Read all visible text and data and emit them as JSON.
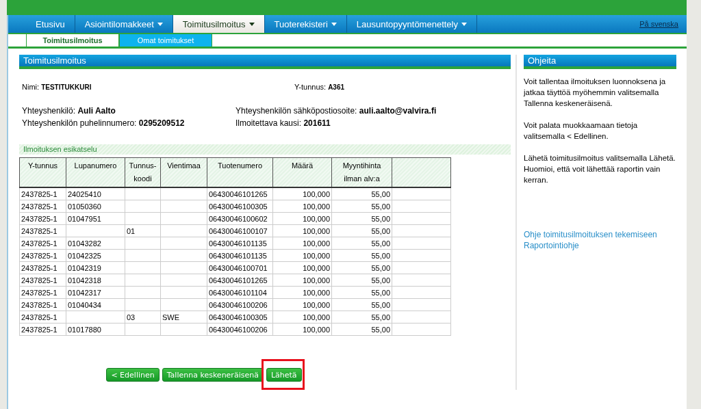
{
  "nav": {
    "tabs": [
      {
        "label": "Etusivu",
        "dropdown": false,
        "selected": false
      },
      {
        "label": "Asiointilomakkeet",
        "dropdown": true,
        "selected": false
      },
      {
        "label": "Toimitusilmoitus",
        "dropdown": true,
        "selected": true
      },
      {
        "label": "Tuoterekisteri",
        "dropdown": true,
        "selected": false
      },
      {
        "label": "Lausuntopyyntömenettely",
        "dropdown": true,
        "selected": false
      }
    ],
    "language_link": "På svenska"
  },
  "subtabs": [
    {
      "label": "Toimitusilmoitus",
      "selected": true
    },
    {
      "label": "Omat toimitukset",
      "selected": false
    }
  ],
  "panel": {
    "title": "Toimitusilmoitus",
    "company": [
      {
        "label": "Nimi:",
        "value": "TESTITUKKURI"
      },
      {
        "label": "Y-tunnus:",
        "value": "A361"
      }
    ],
    "contact": [
      {
        "label": "Yhteyshenkilö:",
        "value": "Auli Aalto"
      },
      {
        "label": "Yhteyshenkilön sähköpostiosoite:",
        "value": "auli.aalto@valvira.fi"
      },
      {
        "label": "Yhteyshenkilön puhelinnumero:",
        "value": "0295209512"
      },
      {
        "label": "Ilmoitettava kausi:",
        "value": "201611"
      }
    ]
  },
  "preview": {
    "title": "Ilmoituksen esikatselu",
    "columns": [
      "Y-tunnus",
      "Lupanumero",
      "Tunnus-koodi",
      "Vientimaa",
      "Tuotenumero",
      "Määrä",
      "Myyntihinta ilman alv:a"
    ],
    "rows": [
      [
        "2437825-1",
        "24025410",
        null,
        null,
        "06430046101265",
        "100,000",
        "55,00"
      ],
      [
        "2437825-1",
        "01050360",
        null,
        null,
        "06430046100305",
        "100,000",
        "55,00"
      ],
      [
        "2437825-1",
        "01047951",
        null,
        null,
        "06430046100602",
        "100,000",
        "55,00"
      ],
      [
        "2437825-1",
        null,
        "01",
        null,
        "06430046100107",
        "100,000",
        "55,00"
      ],
      [
        "2437825-1",
        "01043282",
        null,
        null,
        "06430046101135",
        "100,000",
        "55,00"
      ],
      [
        "2437825-1",
        "01042325",
        null,
        null,
        "06430046101135",
        "100,000",
        "55,00"
      ],
      [
        "2437825-1",
        "01042319",
        null,
        null,
        "06430046100701",
        "100,000",
        "55,00"
      ],
      [
        "2437825-1",
        "01042318",
        null,
        null,
        "06430046101265",
        "100,000",
        "55,00"
      ],
      [
        "2437825-1",
        "01042317",
        null,
        null,
        "06430046101104",
        "100,000",
        "55,00"
      ],
      [
        "2437825-1",
        "01040434",
        null,
        null,
        "06430046100206",
        "100,000",
        "55,00"
      ],
      [
        "2437825-1",
        null,
        "03",
        "SWE",
        "06430046100305",
        "100,000",
        "55,00"
      ],
      [
        "2437825-1",
        "01017880",
        null,
        null,
        "06430046100206",
        "100,000",
        "55,00"
      ]
    ]
  },
  "buttons": [
    {
      "label": "< Edellinen",
      "highlighted": false
    },
    {
      "label": "Tallenna keskeneräisenä",
      "highlighted": false
    },
    {
      "label": "Lähetä",
      "highlighted": true
    }
  ],
  "help": {
    "title": "Ohjeita",
    "paragraphs": [
      "Voit tallentaa ilmoituksen luonnoksena ja jatkaa täyttöä myöhemmin valitsemalla Tallenna keskeneräisenä.",
      "Voit palata muokkaamaan tietoja valitsemalla < Edellinen.",
      "Lähetä toimitusilmoitus valitsemalla Lähetä. Huomioi, että voit lähettää raportin vain kerran."
    ],
    "links": [
      "Ohje toimitusilmoituksen tekemiseen",
      "Raportointiohje"
    ]
  }
}
